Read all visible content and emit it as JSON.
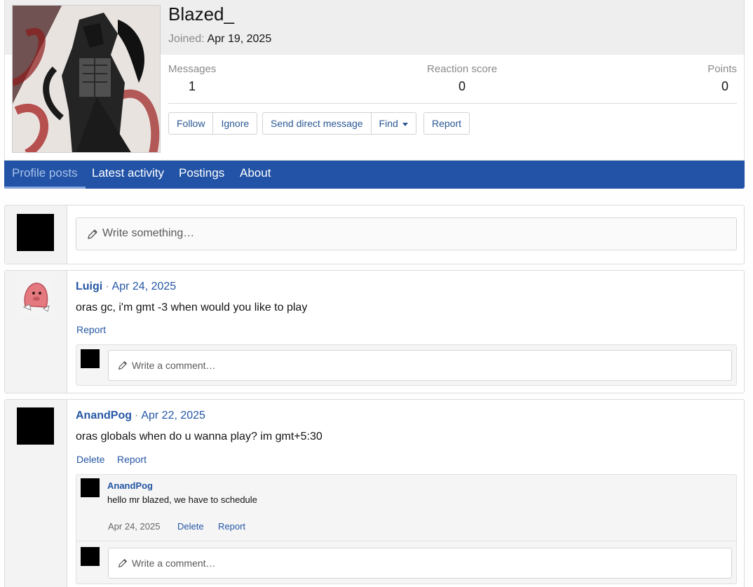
{
  "profile": {
    "username": "Blazed_",
    "joined_label": "Joined:",
    "joined_date": "Apr 19, 2025",
    "stats": [
      {
        "label": "Messages",
        "value": "1"
      },
      {
        "label": "Reaction score",
        "value": "0"
      },
      {
        "label": "Points",
        "value": "0"
      }
    ],
    "buttons": {
      "follow": "Follow",
      "ignore": "Ignore",
      "message": "Send direct message",
      "find": "Find",
      "report": "Report"
    }
  },
  "tabs": [
    "Profile posts",
    "Latest activity",
    "Postings",
    "About"
  ],
  "new_post": {
    "placeholder": "Write something…"
  },
  "posts": [
    {
      "user": "Luigi",
      "date": "Apr 24, 2025",
      "body": "oras gc, i'm gmt -3 when would you like to play",
      "actions": [
        "Report"
      ],
      "comment_placeholder": "Write a comment…"
    },
    {
      "user": "AnandPog",
      "date": "Apr 22, 2025",
      "body": "oras globals when do u wanna play? im gmt+5:30",
      "actions": [
        "Delete",
        "Report"
      ],
      "reply": {
        "user": "AnandPog",
        "body": "hello mr blazed, we have to schedule",
        "date": "Apr 24, 2025",
        "actions": [
          "Delete",
          "Report"
        ]
      },
      "comment_placeholder": "Write a comment…"
    }
  ],
  "colors": {
    "accent": "#2253a6",
    "link": "#2456a4",
    "muted": "#8a8a8a"
  }
}
